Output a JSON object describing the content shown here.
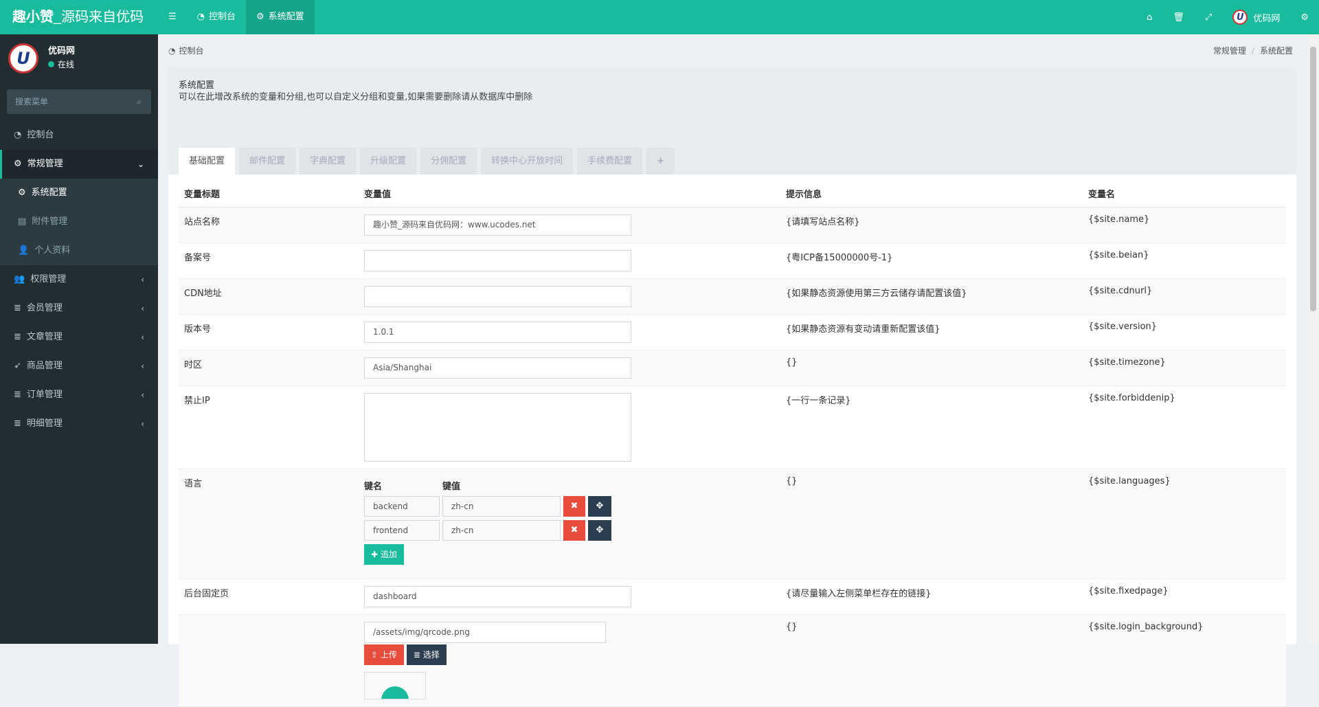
{
  "brand": {
    "bold": "趣小赞",
    "rest": "_源码来自优码"
  },
  "topnav": {
    "menu_toggle_icon": "bars-icon",
    "dashboard": "控制台",
    "sysconfig": "系统配置",
    "user": "优码网"
  },
  "sidebar": {
    "user_name": "优码网",
    "status": "在线",
    "search_placeholder": "搜索菜单",
    "items": [
      {
        "label": "控制台",
        "icon": "dashboard-icon"
      },
      {
        "label": "常规管理",
        "icon": "cogs-icon"
      },
      {
        "label": "系统配置",
        "icon": "gear-icon"
      },
      {
        "label": "附件管理",
        "icon": "file-image-icon"
      },
      {
        "label": "个人资料",
        "icon": "user-icon"
      },
      {
        "label": "权限管理",
        "icon": "group-icon"
      },
      {
        "label": "会员管理",
        "icon": "list-icon"
      },
      {
        "label": "文章管理",
        "icon": "list-icon"
      },
      {
        "label": "商品管理",
        "icon": "rocket-icon"
      },
      {
        "label": "订单管理",
        "icon": "list-icon"
      },
      {
        "label": "明细管理",
        "icon": "list-icon"
      }
    ]
  },
  "breadcrumb": {
    "left": "控制台",
    "r1": "常规管理",
    "r2": "系统配置"
  },
  "panel": {
    "title": "系统配置",
    "desc": "可以在此增改系统的变量和分组,也可以自定义分组和变量,如果需要删除请从数据库中删除",
    "tabs": [
      "基础配置",
      "邮件配置",
      "字典配置",
      "升级配置",
      "分佣配置",
      "转换中心开放时间",
      "手续费配置",
      "+"
    ]
  },
  "table": {
    "headers": [
      "变量标题",
      "变量值",
      "提示信息",
      "变量名"
    ],
    "rows": [
      {
        "title": "站点名称",
        "value": "趣小赞_源码来自优码网：www.ucodes.net",
        "tip": "{请填写站点名称}",
        "name": "{$site.name}"
      },
      {
        "title": "备案号",
        "value": "",
        "tip": "{粤ICP备15000000号-1}",
        "name": "{$site.beian}"
      },
      {
        "title": "CDN地址",
        "value": "",
        "tip": "{如果静态资源使用第三方云储存请配置该值}",
        "name": "{$site.cdnurl}"
      },
      {
        "title": "版本号",
        "value": "1.0.1",
        "tip": "{如果静态资源有变动请重新配置该值}",
        "name": "{$site.version}"
      },
      {
        "title": "时区",
        "value": "Asia/Shanghai",
        "tip": "{}",
        "name": "{$site.timezone}"
      },
      {
        "title": "禁止IP",
        "value": "",
        "tip": "{一行一条记录}",
        "name": "{$site.forbiddenip}"
      },
      {
        "title": "语言",
        "tip": "{}",
        "name": "{$site.languages}"
      },
      {
        "title": "后台固定页",
        "value": "dashboard",
        "tip": "{请尽量输入左侧菜单栏存在的链接}",
        "name": "{$site.fixedpage}"
      },
      {
        "title": "",
        "value": "/assets/img/qrcode.png",
        "tip": "{}",
        "name": "{$site.login_background}"
      }
    ],
    "languages": {
      "key_header": "键名",
      "value_header": "键值",
      "pairs": [
        {
          "key": "backend",
          "value": "zh-cn"
        },
        {
          "key": "frontend",
          "value": "zh-cn"
        }
      ],
      "add_label": "追加"
    },
    "upload_label": "上传",
    "choose_label": "选择"
  }
}
